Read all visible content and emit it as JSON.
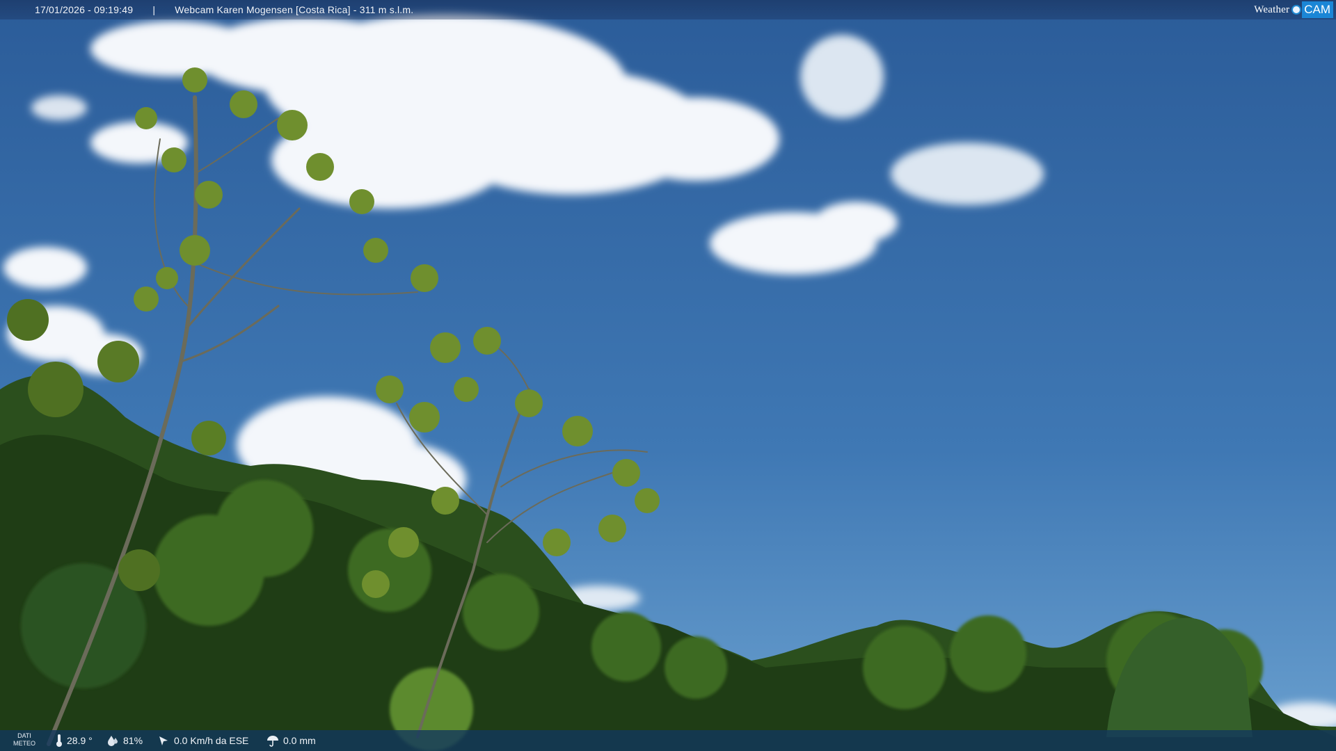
{
  "header": {
    "datetime": "17/01/2026 - 09:19:49",
    "separator": "|",
    "location": "Webcam Karen Mogensen [Costa Rica] - 311 m s.l.m."
  },
  "logo": {
    "weather_text": "Weather",
    "cam_text": "CAM"
  },
  "weather": {
    "label": "DATI METEO",
    "temperature": "28.9 °",
    "humidity": "81%",
    "wind": "0.0 Km/h da ESE",
    "rain": "0.0 mm"
  },
  "colors": {
    "sky_top": "#2c5f9d",
    "sky_bottom": "#5e95c9",
    "foliage": "#2f5a1c",
    "logo_cam": "#1b86d6"
  }
}
